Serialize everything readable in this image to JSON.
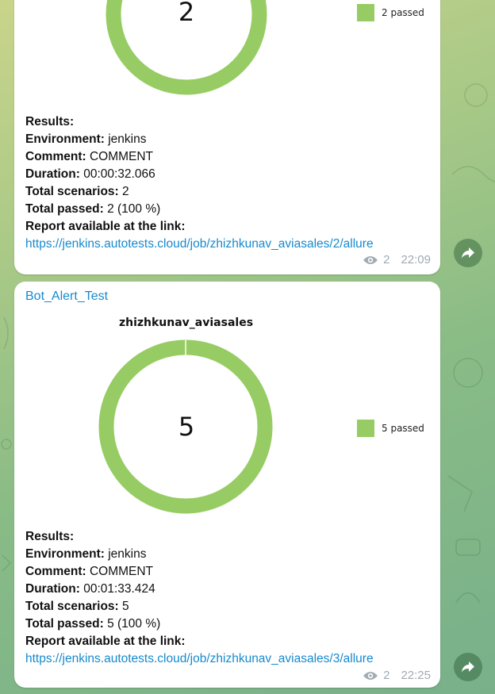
{
  "messages": [
    {
      "sender": "",
      "chart": {
        "title": "",
        "total": "2",
        "legend": "2 passed"
      },
      "results": {
        "heading": "Results:",
        "environment_label": "Environment:",
        "environment_value": " jenkins",
        "comment_label": "Comment:",
        "comment_value": " COMMENT",
        "duration_label": "Duration:",
        "duration_value": " 00:00:32.066",
        "scenarios_label": "Total scenarios:",
        "scenarios_value": " 2",
        "passed_label": "Total passed:",
        "passed_value": " 2 (100 %)",
        "report_label": "Report available at the link:",
        "link": "https://jenkins.autotests.cloud/job/zhizhkunav_aviasales/2/allure"
      },
      "views": "2",
      "time": "22:09"
    },
    {
      "sender": "Bot_Alert_Test",
      "chart": {
        "title": "zhizhkunav_aviasales",
        "total": "5",
        "legend": "5 passed"
      },
      "results": {
        "heading": "Results:",
        "environment_label": "Environment:",
        "environment_value": " jenkins",
        "comment_label": "Comment:",
        "comment_value": " COMMENT",
        "duration_label": "Duration:",
        "duration_value": " 00:01:33.424",
        "scenarios_label": "Total scenarios:",
        "scenarios_value": " 5",
        "passed_label": "Total passed:",
        "passed_value": " 5 (100 %)",
        "report_label": "Report available at the link:",
        "link": "https://jenkins.autotests.cloud/job/zhizhkunav_aviasales/3/allure"
      },
      "views": "2",
      "time": "22:25"
    }
  ],
  "colors": {
    "passed": "#97cc64",
    "link": "#168acd",
    "meta": "#a0abb3"
  },
  "icons": {
    "views": "eye-icon",
    "share": "share-arrow-icon"
  }
}
